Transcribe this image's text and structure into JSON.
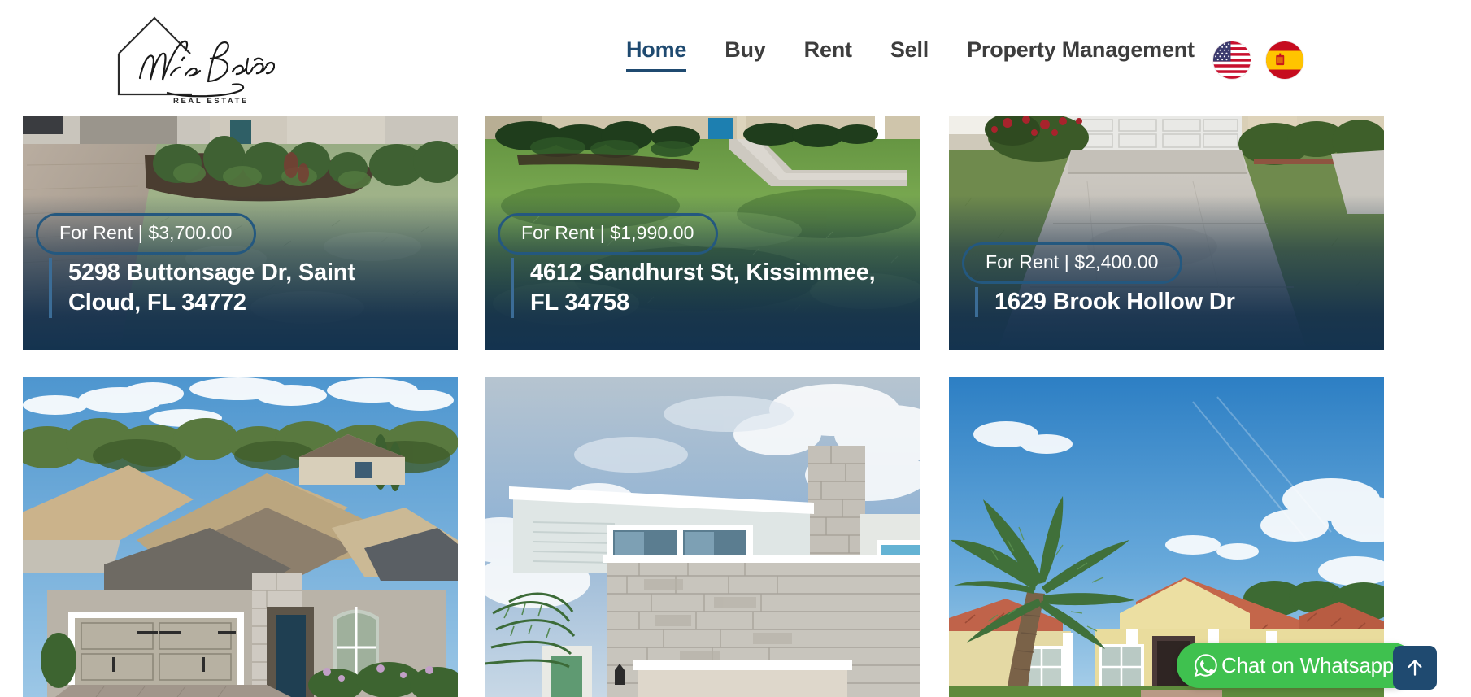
{
  "site": {
    "brand_name": "Mike Bolaños",
    "brand_tagline": "REAL ESTATE",
    "accent_navy": "#1f4a70",
    "card_overlay_navy": "#14334f",
    "whatsapp_green": "#3fc14f"
  },
  "nav": {
    "items": [
      {
        "label": "Home",
        "active": true
      },
      {
        "label": "Buy",
        "active": false
      },
      {
        "label": "Rent",
        "active": false
      },
      {
        "label": "Sell",
        "active": false
      },
      {
        "label": "Property Management",
        "active": false
      }
    ],
    "language_flags": [
      {
        "name": "english-flag",
        "country": "United States"
      },
      {
        "name": "spanish-flag",
        "country": "Spain"
      }
    ]
  },
  "listings": {
    "row1": [
      {
        "badge": "For Rent | $3,700.00",
        "address": "5298 Buttonsage Dr, Saint Cloud, FL 34772",
        "photo": "paver-driveway-landscaped-front-yard"
      },
      {
        "badge": "For Rent | $1,990.00",
        "address": "4612 Sandhurst St, Kissimmee, FL 34758",
        "photo": "green-lawn-walkway-stucco-home"
      },
      {
        "badge": "For Rent | $2,400.00",
        "address": "1629 Brook Hollow Dr",
        "photo": "concrete-driveway-white-garage-door"
      }
    ],
    "row2": [
      {
        "photo": "aerial-gray-stone-single-story-home"
      },
      {
        "photo": "two-story-stone-townhouse"
      },
      {
        "photo": "yellow-stucco-home-with-palm-tree"
      }
    ]
  },
  "widgets": {
    "whatsapp_label": "Chat on Whatsapp",
    "scroll_top_label": "Scroll to top"
  }
}
